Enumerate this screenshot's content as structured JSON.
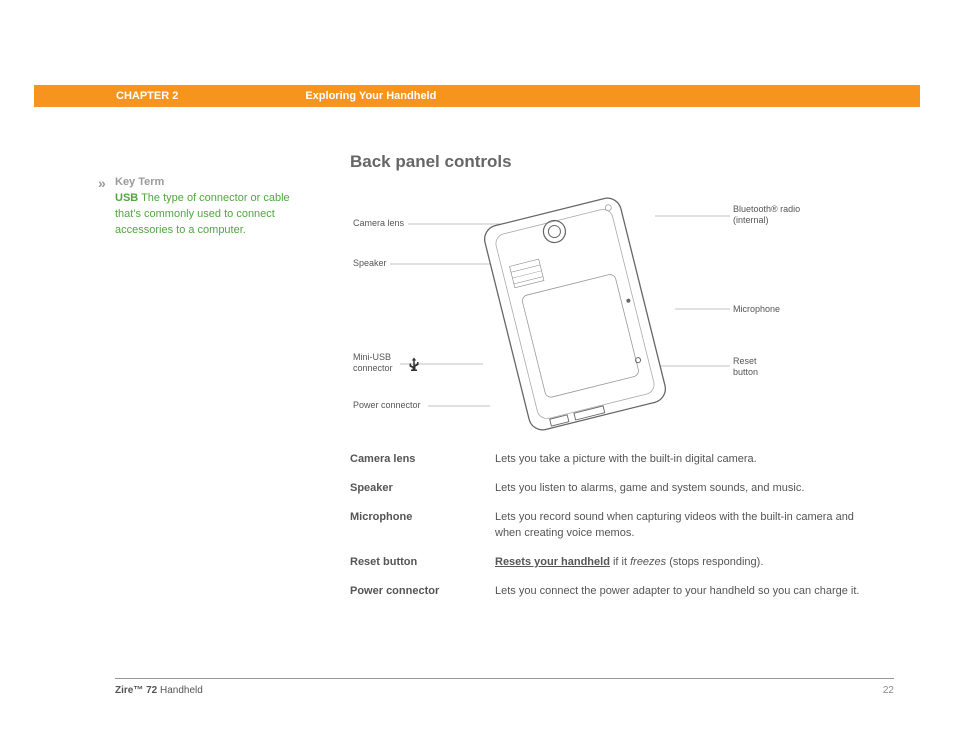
{
  "header": {
    "chapter": "CHAPTER 2",
    "section": "Exploring Your Handheld"
  },
  "sidebar": {
    "key_term_label": "Key Term",
    "term_name": "USB",
    "term_body": " The type of connector or cable that's commonly used to connect accessories to a computer."
  },
  "heading": "Back panel controls",
  "diagram_labels": {
    "camera_lens": "Camera lens",
    "speaker": "Speaker",
    "mini_usb": "Mini-USB connector",
    "power_connector": "Power connector",
    "bluetooth": "Bluetooth® radio (internal)",
    "microphone": "Microphone",
    "reset_button": "Reset button"
  },
  "descriptions": [
    {
      "term": "Camera lens",
      "def_before": "Lets you take a picture with the built-in digital camera.",
      "link": "",
      "def_after": ""
    },
    {
      "term": "Speaker",
      "def_before": "Lets you listen to alarms, game and system sounds, and music.",
      "link": "",
      "def_after": ""
    },
    {
      "term": "Microphone",
      "def_before": "Lets you record sound when capturing videos with the built-in camera and when creating voice memos.",
      "link": "",
      "def_after": ""
    },
    {
      "term": "Reset button",
      "def_before": "",
      "link": "Resets your handheld",
      "def_after": " if it freezes (stops responding)."
    },
    {
      "term": "Power connector",
      "def_before": "Lets you connect the power adapter to your handheld so you can charge it.",
      "link": "",
      "def_after": ""
    }
  ],
  "footer": {
    "product_bold": "Zire™ 72",
    "product_rest": " Handheld",
    "page": "22"
  }
}
